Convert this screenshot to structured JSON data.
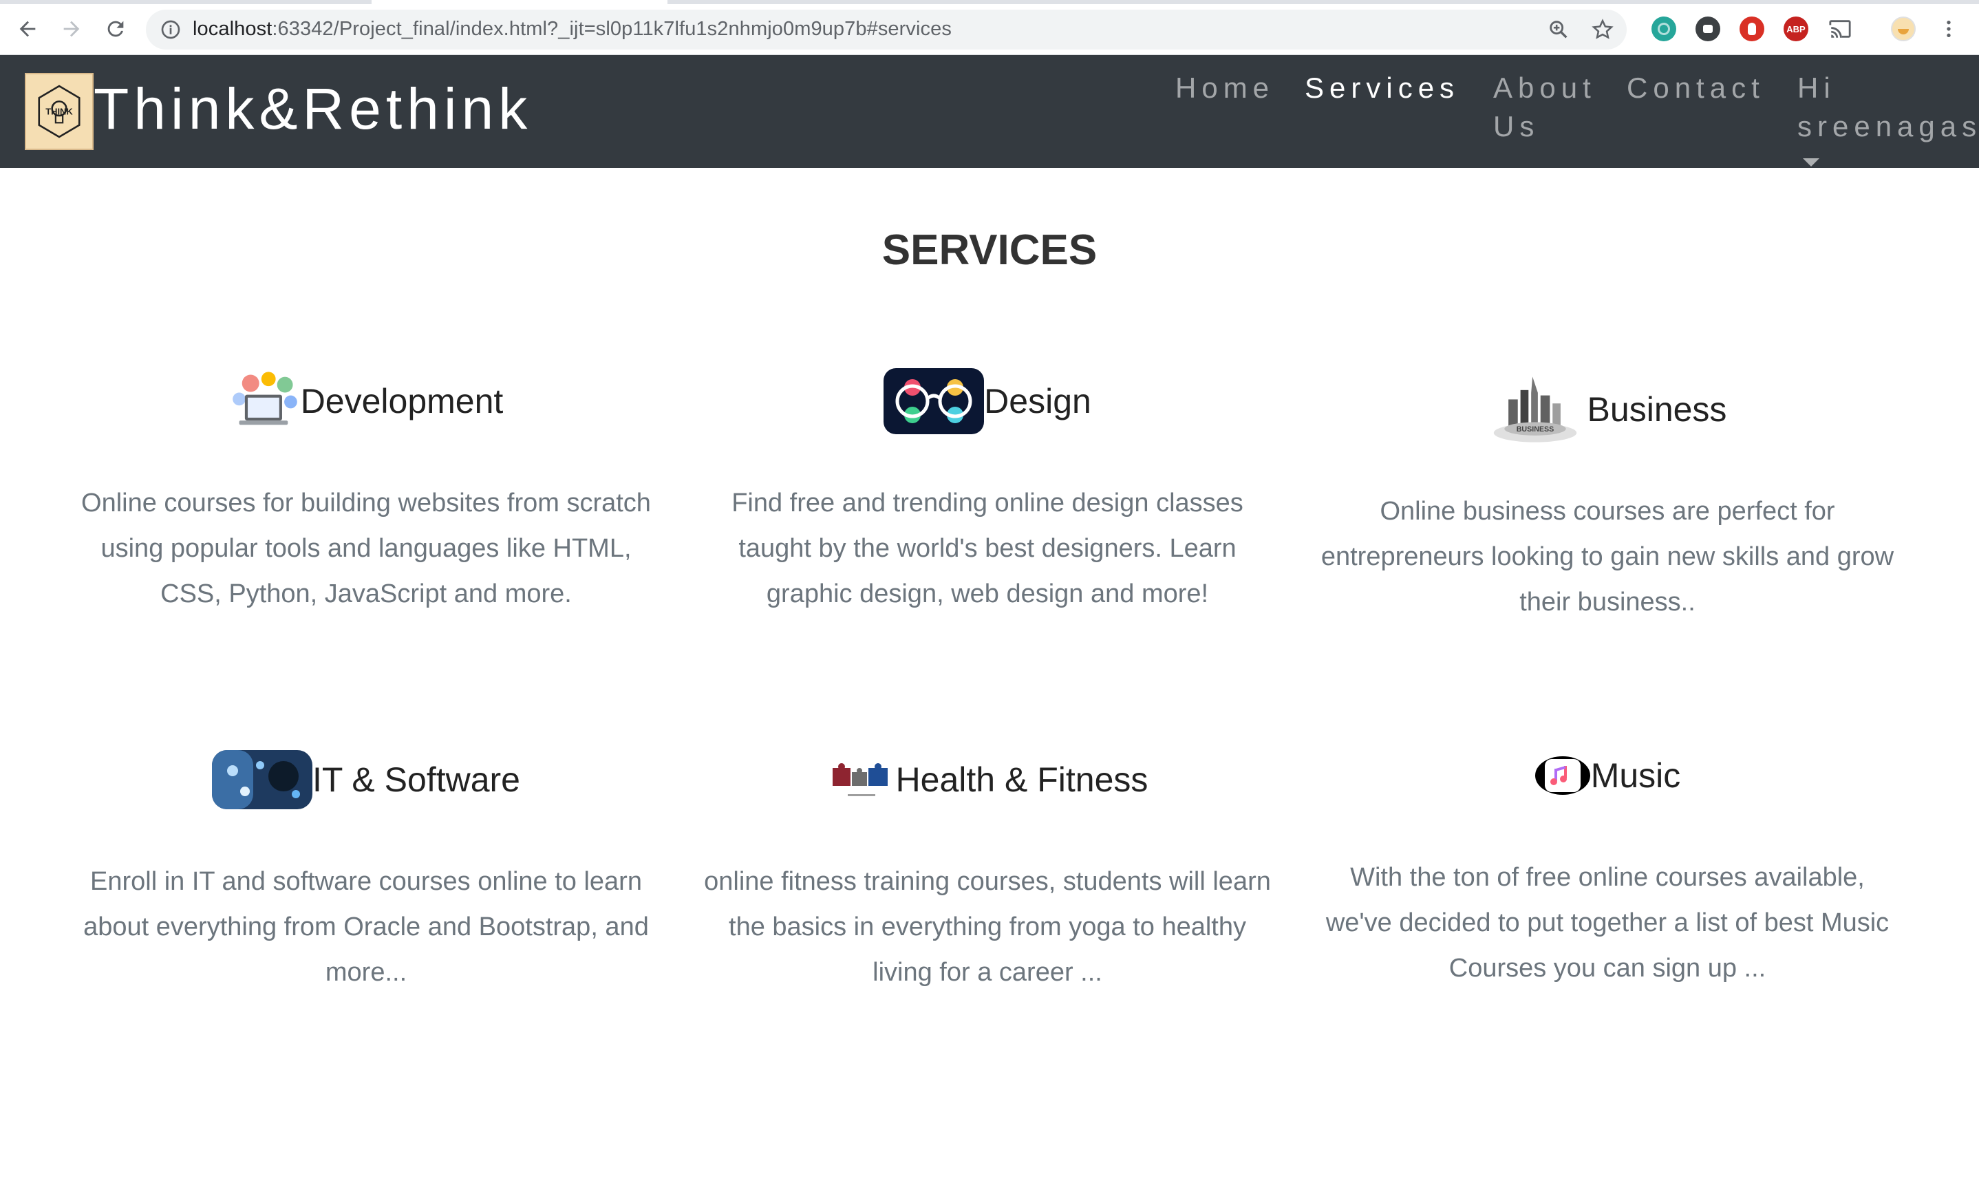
{
  "browser": {
    "url_host": "localhost",
    "url_rest": ":63342/Project_final/index.html?_ijt=sl0p11k7lfu1s2nhmjo0m9up7b#services",
    "extensions": [
      "meet-extension-icon",
      "video-extension-icon",
      "shield-extension-icon",
      "adblock-extension-icon",
      "cast-icon"
    ],
    "abp_label": "ABP"
  },
  "navbar": {
    "brand": "Think&Rethink",
    "logo_text": "THINK",
    "links": [
      {
        "label": "Home",
        "active": false
      },
      {
        "label": "Services",
        "active": true
      },
      {
        "label_line1": "About",
        "label_line2": "Us",
        "active": false
      },
      {
        "label": "Contact",
        "active": false
      },
      {
        "label_line1": "Hi",
        "label_line2": "sreenagas",
        "active": false
      }
    ]
  },
  "page": {
    "title": "SERVICES"
  },
  "services": [
    {
      "title": "Development",
      "icon": "development-icon",
      "description": "Online courses for building websites from scratch using popular tools and languages like HTML, CSS, Python, JavaScript and more."
    },
    {
      "title": "Design",
      "icon": "design-glasses-icon",
      "description": "Find free and trending online design classes taught by the world's best designers. Learn graphic design, web design and more!"
    },
    {
      "title": "Business",
      "icon": "business-city-icon",
      "icon_text": "BUSINESS",
      "description": "Online business courses are perfect for entrepreneurs looking to gain new skills and grow their business.."
    },
    {
      "title": "IT & Software",
      "icon": "it-software-icon",
      "description": "Enroll in IT and software courses online to learn about everything from Oracle and Bootstrap, and more..."
    },
    {
      "title": "Health & Fitness",
      "icon": "health-fitness-puzzle-icon",
      "description": "online fitness training courses, students will learn the basics in everything from yoga to healthy living for a career ..."
    },
    {
      "title": "Music",
      "icon": "music-note-icon",
      "description": "With the ton of free online courses available, we've decided to put together a list of best Music Courses you can sign up ..."
    }
  ],
  "colors": {
    "navbar_bg": "#343a40",
    "desc_text": "#6c757d",
    "logo_bg": "#f5deb3"
  }
}
